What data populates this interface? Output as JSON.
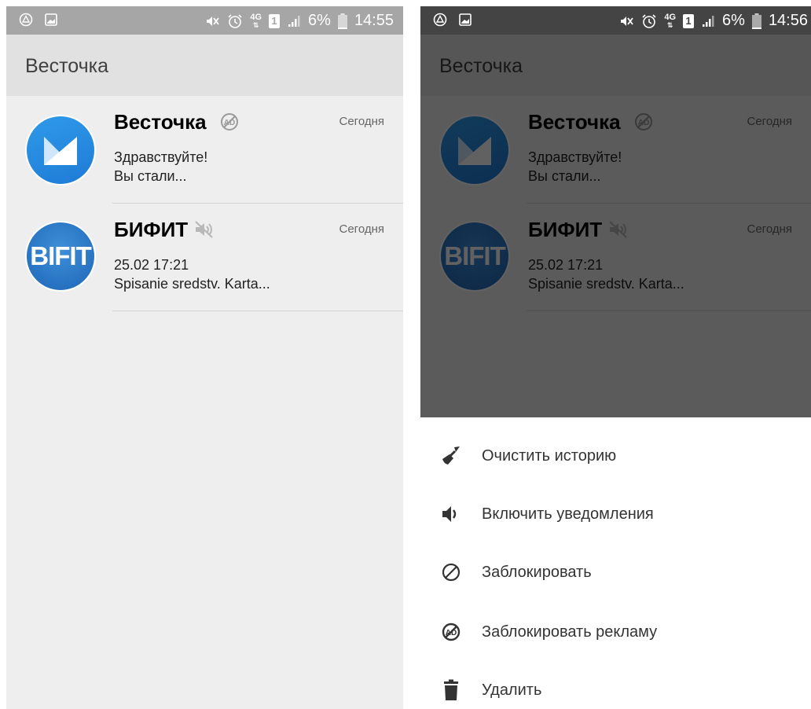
{
  "status_bar_left": {
    "time": "14:55",
    "battery": "6%",
    "network": "4G",
    "sim": "1"
  },
  "status_bar_right": {
    "time": "14:56",
    "battery": "6%",
    "network": "4G",
    "sim": "1"
  },
  "app_title": "Весточка",
  "chats": [
    {
      "name": "Весточка",
      "date": "Сегодня",
      "line1": "Здравствуйте!",
      "line2": "Вы стали...",
      "badge_icon": "no-ads-icon"
    },
    {
      "name": "БИФИТ",
      "date": "Сегодня",
      "line1": "25.02 17:21",
      "line2": "Spisanie sredstv. Karta...",
      "badge_icon": "muted-icon",
      "avatar_text": "BIFIT"
    }
  ],
  "menu": [
    {
      "label": "Очистить историю",
      "icon": "broom-icon"
    },
    {
      "label": "Включить уведомления",
      "icon": "speaker-icon"
    },
    {
      "label": "Заблокировать",
      "icon": "block-icon"
    },
    {
      "label": "Заблокировать рекламу",
      "icon": "no-ads-icon"
    },
    {
      "label": "Удалить",
      "icon": "trash-icon"
    }
  ],
  "colors": {
    "accent": "#1e7bd6",
    "app_bar": "#e1e1e1",
    "background": "#eeeeee"
  }
}
